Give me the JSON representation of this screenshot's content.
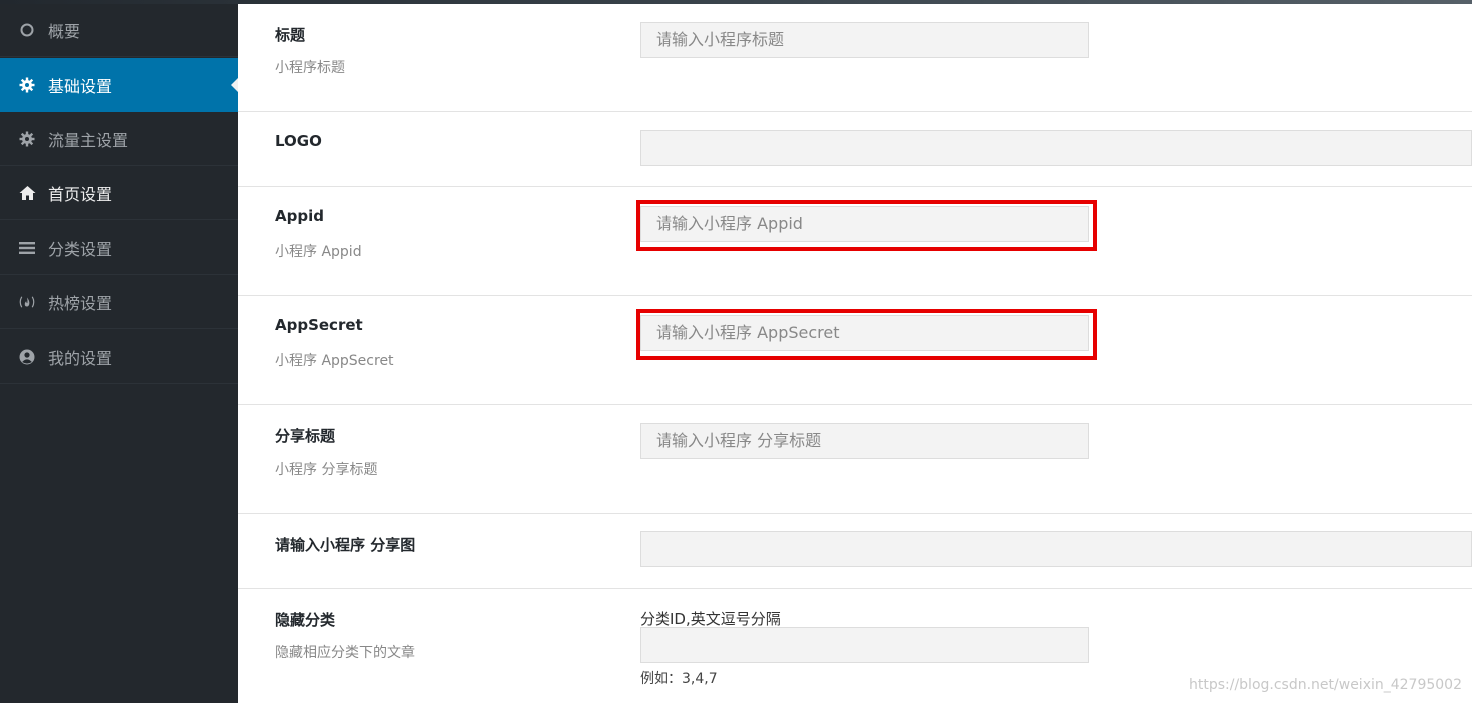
{
  "sidebar": {
    "items": [
      {
        "label": "概要",
        "icon": "circle-outline-icon"
      },
      {
        "label": "基础设置",
        "icon": "gear-icon",
        "active": true
      },
      {
        "label": "流量主设置",
        "icon": "gear-icon"
      },
      {
        "label": "首页设置",
        "icon": "home-icon"
      },
      {
        "label": "分类设置",
        "icon": "bars-icon"
      },
      {
        "label": "热榜设置",
        "icon": "fire-broadcast-icon"
      },
      {
        "label": "我的设置",
        "icon": "user-circle-icon"
      }
    ]
  },
  "form": {
    "title": {
      "label": "标题",
      "desc": "小程序标题",
      "placeholder": "请输入小程序标题"
    },
    "logo": {
      "label": "LOGO"
    },
    "appid": {
      "label": "Appid",
      "desc": "小程序 Appid",
      "placeholder": "请输入小程序 Appid"
    },
    "appsecret": {
      "label": "AppSecret",
      "desc": "小程序 AppSecret",
      "placeholder": "请输入小程序 AppSecret"
    },
    "share_title": {
      "label": "分享标题",
      "desc": "小程序 分享标题",
      "placeholder": "请输入小程序 分享标题"
    },
    "share_image": {
      "label": "请输入小程序 分享图"
    },
    "hide_category": {
      "label": "隐藏分类",
      "desc": "隐藏相应分类下的文章",
      "note": "分类ID,英文逗号分隔",
      "example": "例如：3,4,7"
    }
  },
  "colors": {
    "sidebar_bg": "#23282d",
    "active_bg": "#0073aa",
    "highlight_border": "#e60000"
  },
  "watermark": "https://blog.csdn.net/weixin_42795002"
}
